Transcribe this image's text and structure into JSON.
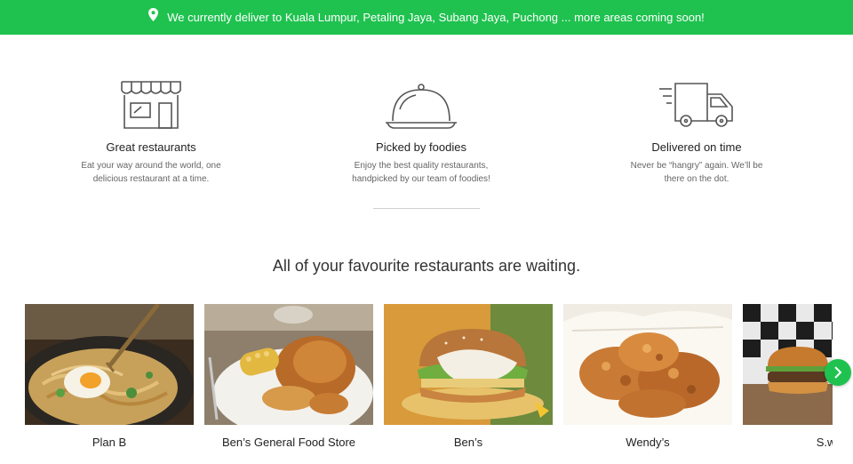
{
  "banner": {
    "text": "We currently deliver to Kuala Lumpur, Petaling Jaya, Subang Jaya, Puchong ... more areas coming soon!",
    "icon": "location-pin-icon",
    "color": "#1fc24f"
  },
  "features": [
    {
      "icon": "storefront-icon",
      "title": "Great restaurants",
      "desc_line1": "Eat your way around the world, one",
      "desc_line2": "delicious restaurant at a time."
    },
    {
      "icon": "food-cloche-icon",
      "title": "Picked by foodies",
      "desc_line1": "Enjoy the best quality restaurants,",
      "desc_line2": "handpicked by our team of foodies!"
    },
    {
      "icon": "delivery-truck-icon",
      "title": "Delivered on time",
      "desc_line1": "Never be “hangry” again. We’ll be",
      "desc_line2": "there on the dot."
    }
  ],
  "restaurants_heading": "All of your favourite restaurants are waiting.",
  "restaurants": [
    {
      "name": "Plan B"
    },
    {
      "name": "Ben’s General Food Store"
    },
    {
      "name": "Ben’s"
    },
    {
      "name": "Wendy’s"
    },
    {
      "name": "S.wi"
    }
  ],
  "carousel": {
    "next_icon": "chevron-right-icon"
  },
  "colors": {
    "accent": "#1fc24f",
    "icon_stroke": "#555555"
  }
}
